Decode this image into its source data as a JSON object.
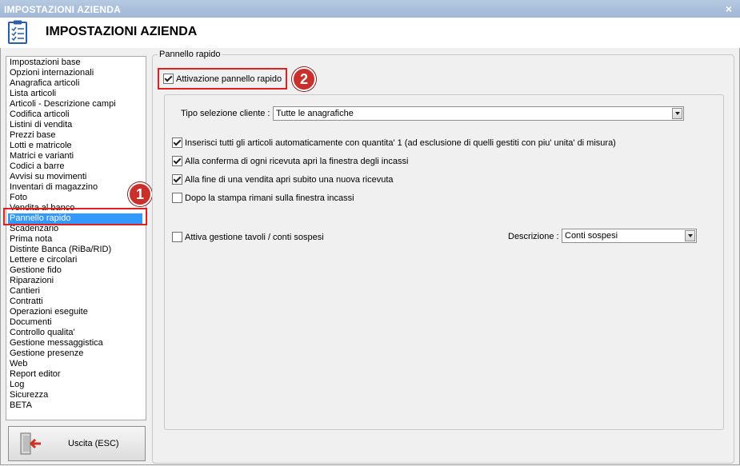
{
  "window": {
    "title": "IMPOSTAZIONI AZIENDA",
    "close_glyph": "×"
  },
  "header": {
    "title": "IMPOSTAZIONI AZIENDA",
    "icon": "checklist-icon"
  },
  "sidebar": {
    "items": [
      "Impostazioni base",
      "Opzioni internazionali",
      "Anagrafica articoli",
      "Lista articoli",
      "Articoli - Descrizione campi",
      "Codifica articoli",
      "Listini di vendita",
      "Prezzi base",
      "Lotti e matricole",
      "Matrici e varianti",
      "Codici a barre",
      "Avvisi su movimenti",
      "Inventari di magazzino",
      "Foto",
      "Vendita al banco",
      "Pannello rapido",
      "Scadenzario",
      "Prima nota",
      "Distinte Banca (RiBa/RID)",
      "Lettere e circolari",
      "Gestione fido",
      "Riparazioni",
      "Cantieri",
      "Contratti",
      "Operazioni eseguite",
      "Documenti",
      "Controllo qualita'",
      "Gestione messaggistica",
      "Gestione presenze",
      "Web",
      "Report editor",
      "Log",
      "Sicurezza",
      "BETA"
    ],
    "selected_index": 15,
    "exit_label": "Uscita (ESC)"
  },
  "annotations": {
    "badge1": "1",
    "badge2": "2",
    "color": "#c9302c"
  },
  "panel": {
    "group_title": "Pannello rapido",
    "activate_label": "Attivazione pannello rapido",
    "activate_checked": true,
    "client_type_label": "Tipo selezione cliente :",
    "client_type_value": "Tutte le anagrafiche",
    "options": [
      {
        "label": "Inserisci tutti gli articoli automaticamente con quantita' 1 (ad esclusione di quelli gestiti con piu' unita' di misura)",
        "checked": true
      },
      {
        "label": "Alla conferma di ogni ricevuta apri la finestra degli incassi",
        "checked": true
      },
      {
        "label": "Alla fine di una vendita apri subito una nuova ricevuta",
        "checked": true
      },
      {
        "label": "Dopo la stampa rimani sulla finestra incassi",
        "checked": false
      }
    ],
    "tables_label": "Attiva gestione tavoli / conti sospesi",
    "tables_checked": false,
    "description_label": "Descrizione :",
    "description_value": "Conti sospesi"
  },
  "colors": {
    "selection": "#3399ff",
    "highlight": "#e02020",
    "titlebar": "#9fb6d4"
  }
}
